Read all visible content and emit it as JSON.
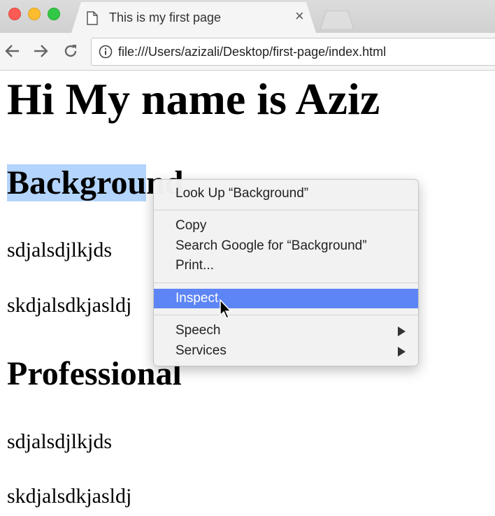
{
  "browser": {
    "tab_title": "This is my first page",
    "tab_close": "×",
    "url": "file:///Users/azizali/Desktop/first-page/index.html",
    "icons": [
      "page-icon",
      "close-icon",
      "back-icon",
      "forward-icon",
      "reload-icon",
      "info-icon"
    ]
  },
  "page": {
    "heading": "Hi My name is Aziz",
    "section1_title_selected": "Backgrou",
    "section1_title_rest": "nd",
    "section1_lines": [
      "sdjalsdjlkjds",
      "skdjalsdkjasldj"
    ],
    "section2_title": "Professional",
    "section2_lines": [
      "sdjalsdjlkjds",
      "skdjalsdkjasldj"
    ]
  },
  "context_menu": {
    "look_up": "Look Up “Background”",
    "copy": "Copy",
    "search_google": "Search Google for “Background”",
    "print": "Print...",
    "inspect": "Inspect",
    "speech": "Speech",
    "services": "Services",
    "highlight_color": "#5d85f5",
    "selection_color": "#b3d4fd"
  }
}
